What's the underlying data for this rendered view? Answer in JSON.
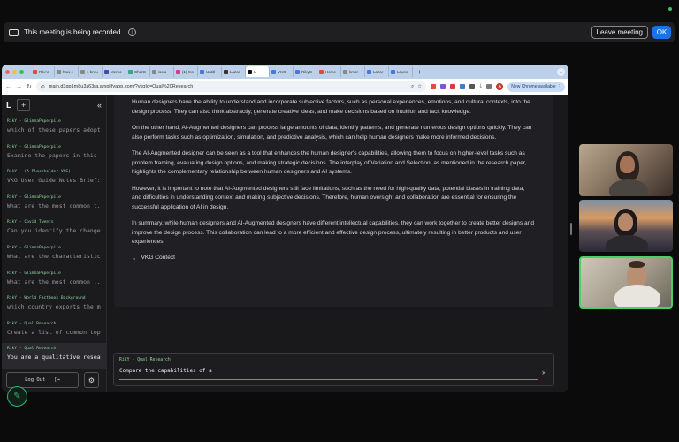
{
  "meeting": {
    "recording_text": "This meeting is being recorded.",
    "info_glyph": "i",
    "leave_label": "Leave meeting",
    "ok_label": "OK"
  },
  "browser": {
    "tabs": [
      {
        "label": "RikAI",
        "color": "#e24c3c"
      },
      {
        "label": "how c",
        "color": "#888888"
      },
      {
        "label": "1 brou",
        "color": "#888888"
      },
      {
        "label": "Memo",
        "color": "#444aa8"
      },
      {
        "label": "ChatG",
        "color": "#3ba58a"
      },
      {
        "label": "isolo",
        "color": "#888888"
      },
      {
        "label": "(1) Ins",
        "color": "#d63c8c"
      },
      {
        "label": "Untitl",
        "color": "#4a78d6"
      },
      {
        "label": "Lazar",
        "color": "#333333"
      },
      {
        "label": "L",
        "color": "#111111",
        "active": true
      },
      {
        "label": "VKG",
        "color": "#4a78d6"
      },
      {
        "label": "RikyC",
        "color": "#4a78d6"
      },
      {
        "label": "Home",
        "color": "#e24c3c"
      },
      {
        "label": "kmor",
        "color": "#888888"
      },
      {
        "label": "Lazar",
        "color": "#4a78d6"
      },
      {
        "label": "Launc",
        "color": "#4a78d6"
      }
    ],
    "url": "main.d3gp1m8u3z63ra.amplifyapp.com/?vkgId=Qual%20Research",
    "new_chrome": "New Chrome available",
    "profile_initial": "A"
  },
  "sidebar": {
    "logo": "L",
    "new_label": "+",
    "collapse_glyph": "«",
    "history": [
      {
        "cat": "RikY - GlimmaPaperpile",
        "q": "which of these papers adopt..."
      },
      {
        "cat": "RikY - GlimmaPaperpile",
        "q": "Examine the papers in this gr..."
      },
      {
        "cat": "RikY - (A Placeholder VKG)",
        "q": "VKG User Guide Notes Brief: ..."
      },
      {
        "cat": "RikY - GlimmaPaperpile",
        "q": "What are the most common t..."
      },
      {
        "cat": "RikY - Covid Tweets",
        "q": "Can you identify the changes ..."
      },
      {
        "cat": "RikY - GlimmaPaperpile",
        "q": "What are the characteristics ..."
      },
      {
        "cat": "RikY - GlimmaPaperpile",
        "q": "What are the most common ..."
      },
      {
        "cat": "RikY - World Factbook Background",
        "q": "which country exports the m..."
      },
      {
        "cat": "RikY - Qual Research",
        "q": "Create a list of common topi..."
      },
      {
        "cat": "RikY - Qual Research",
        "q": "You are a qualitative research...",
        "active": true
      }
    ],
    "logout_label": "Log Out",
    "logout_glyph": "[→"
  },
  "answer": {
    "paragraphs": [
      "Human designers have the ability to understand and incorporate subjective factors, such as personal experiences, emotions, and cultural contexts, into the design process. They can also think abstractly, generate creative ideas, and make decisions based on intuition and tacit knowledge.",
      "On the other hand, AI-Augmented designers can process large amounts of data, identify patterns, and generate numerous design options quickly. They can also perform tasks such as optimization, simulation, and predictive analysis, which can help human designers make more informed decisions.",
      "The AI-Augmented designer can be seen as a tool that enhances the human designer's capabilities, allowing them to focus on higher-level tasks such as problem framing, evaluating design options, and making strategic decisions. The interplay of Variation and Selection, as mentioned in the research paper, highlights the complementary relationship between human designers and AI systems.",
      "However, it is important to note that AI-Augmented designers still face limitations, such as the need for high-quality data, potential biases in training data, and difficulties in understanding context and making subjective decisions. Therefore, human oversight and collaboration are essential for ensuring the successful application of AI in design.",
      "In summary, while human designers and AI-Augmented designers have different intellectual capabilities, they can work together to create better designs and improve the design process. This collaboration can lead to a more efficient and effective design process, ultimately resulting in better products and user experiences."
    ],
    "context_label": "VKG Context"
  },
  "input": {
    "category": "RikY - Qual Research",
    "value": "Compare the capabilities of a"
  },
  "colors": {
    "accent": "#2fb37a",
    "active_speaker": "#48d16a",
    "ok_blue": "#1a73e8"
  }
}
